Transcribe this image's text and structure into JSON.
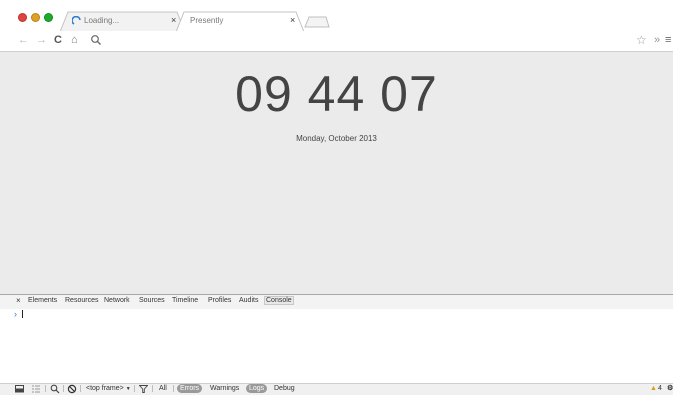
{
  "window": {
    "traffic_lights": {
      "close_color": "#e0443e",
      "minimize_color": "#dea123",
      "zoom_color": "#1aab29"
    }
  },
  "tabs": [
    {
      "title": "Loading...",
      "close": "×",
      "loading_indicator_color": "#2f7dd1"
    },
    {
      "title": "Presently",
      "close": "×"
    }
  ],
  "toolbar": {
    "back": "←",
    "forward": "→",
    "reload": "C",
    "home": "⌂",
    "address_value": "",
    "star": "☆",
    "overflow": "»",
    "menu": "≡"
  },
  "page": {
    "clock": "09 44 07",
    "date": "Monday, October 2013",
    "background_color": "#ebebeb",
    "text_color": "#444444"
  },
  "devtools": {
    "close": "×",
    "tabs": [
      "Elements",
      "Resources",
      "Network",
      "Sources",
      "Timeline",
      "Profiles",
      "Audits",
      "Console"
    ],
    "active_tab": "Console",
    "prompt": "›",
    "status": {
      "frame_select": "<top frame>",
      "frame_arrow": "▼",
      "filters": [
        "All",
        "Errors",
        "Warnings",
        "Logs",
        "Debug"
      ],
      "highlighted_filters": [
        "Errors",
        "Logs"
      ],
      "warning_count": "4"
    }
  }
}
